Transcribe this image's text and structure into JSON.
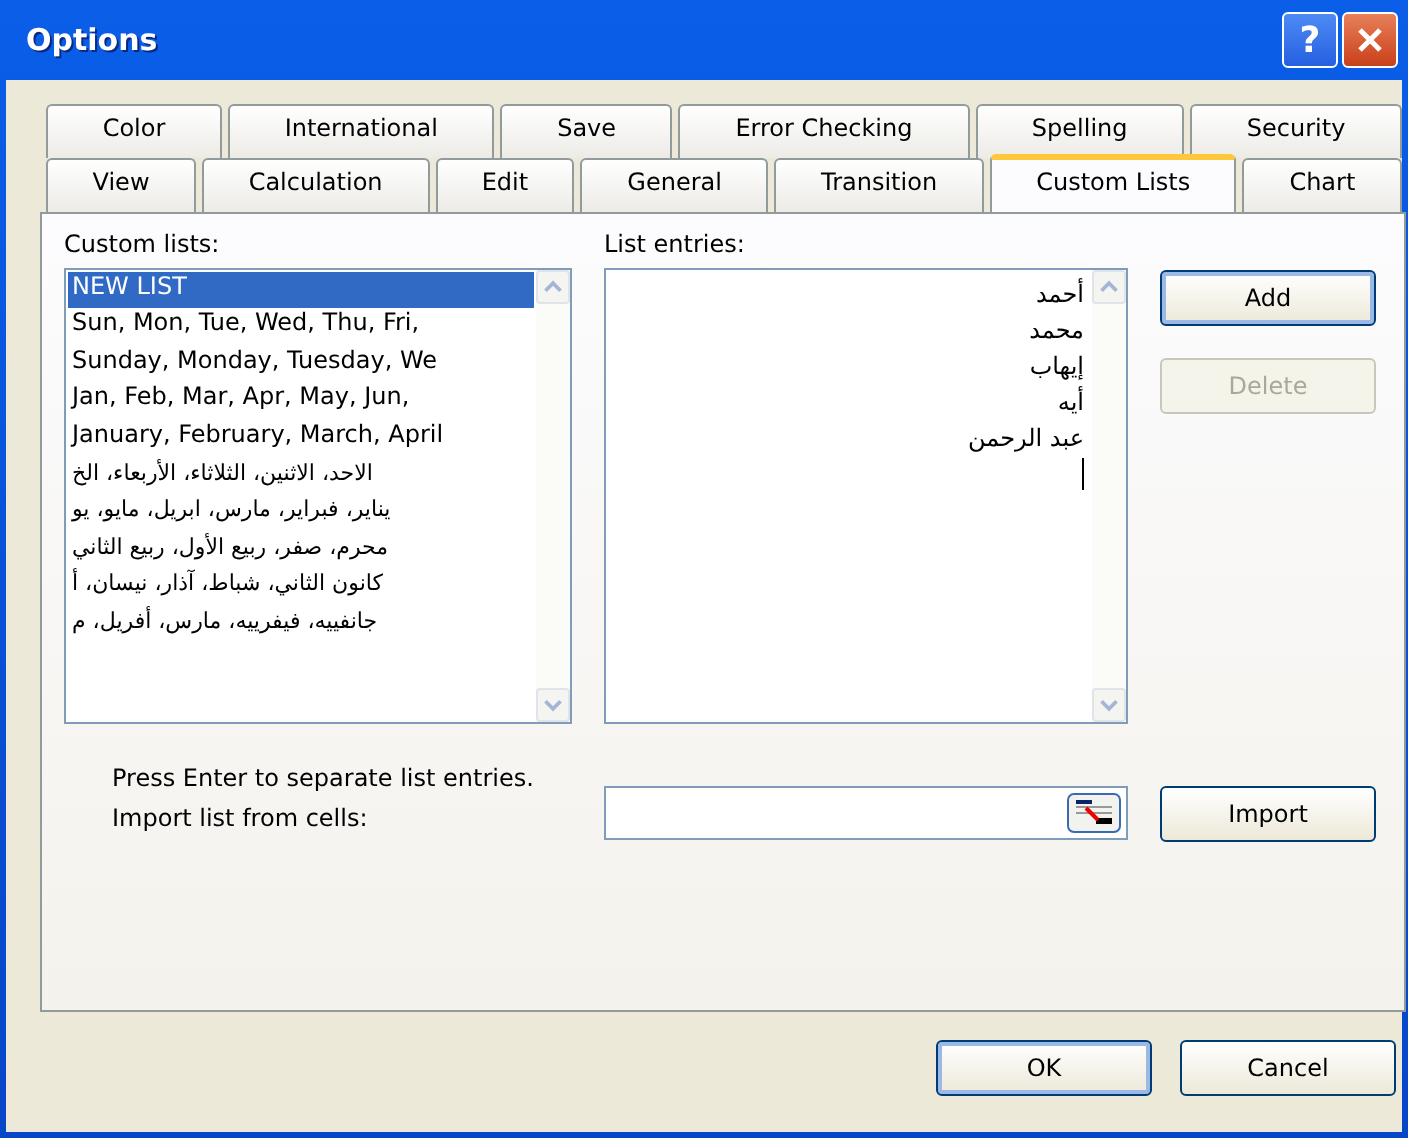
{
  "window": {
    "title": "Options",
    "help_button": "?"
  },
  "tab_rows": [
    [
      {
        "label": "Color",
        "selected": false
      },
      {
        "label": "International",
        "selected": false
      },
      {
        "label": "Save",
        "selected": false
      },
      {
        "label": "Error Checking",
        "selected": false
      },
      {
        "label": "Spelling",
        "selected": false
      },
      {
        "label": "Security",
        "selected": false
      }
    ],
    [
      {
        "label": "View",
        "selected": false
      },
      {
        "label": "Calculation",
        "selected": false
      },
      {
        "label": "Edit",
        "selected": false
      },
      {
        "label": "General",
        "selected": false
      },
      {
        "label": "Transition",
        "selected": false
      },
      {
        "label": "Custom Lists",
        "selected": true
      },
      {
        "label": "Chart",
        "selected": false
      }
    ]
  ],
  "custom_lists": {
    "label": "Custom lists:",
    "items": [
      {
        "text": "NEW LIST",
        "selected": true,
        "kind": "latin"
      },
      {
        "text": "Sun, Mon, Tue, Wed, Thu, Fri,",
        "selected": false,
        "kind": "latin"
      },
      {
        "text": "Sunday, Monday, Tuesday, We",
        "selected": false,
        "kind": "latin"
      },
      {
        "text": "Jan, Feb, Mar, Apr, May, Jun,",
        "selected": false,
        "kind": "latin"
      },
      {
        "text": "January, February, March, April",
        "selected": false,
        "kind": "latin"
      },
      {
        "text": "الاحد، الاثنين، الثلاثاء، الأربعاء، الخ",
        "selected": false,
        "kind": "arabic"
      },
      {
        "text": "يناير، فبراير، مارس، ابريل، مايو، يو",
        "selected": false,
        "kind": "arabic"
      },
      {
        "text": "محرم، صفر، ربيع الأول، ربيع الثاني",
        "selected": false,
        "kind": "arabic"
      },
      {
        "text": "كانون الثاني، شباط، آذار، نيسان، أ",
        "selected": false,
        "kind": "arabic"
      },
      {
        "text": "جانفييه، فيفرييه، مارس، أفريل، م",
        "selected": false,
        "kind": "arabic"
      }
    ]
  },
  "list_entries": {
    "label": "List entries:",
    "entries": [
      "أحمد",
      "محمد",
      "إيهاب",
      "أيه",
      "عبد الرحمن"
    ]
  },
  "side_buttons": [
    {
      "label": "Add",
      "disabled": false
    },
    {
      "label": "Delete",
      "disabled": true
    }
  ],
  "hint": "Press Enter to separate list entries.",
  "import": {
    "label": "Import list from cells:",
    "button": "Import"
  },
  "footer_buttons": [
    "OK",
    "Cancel"
  ]
}
